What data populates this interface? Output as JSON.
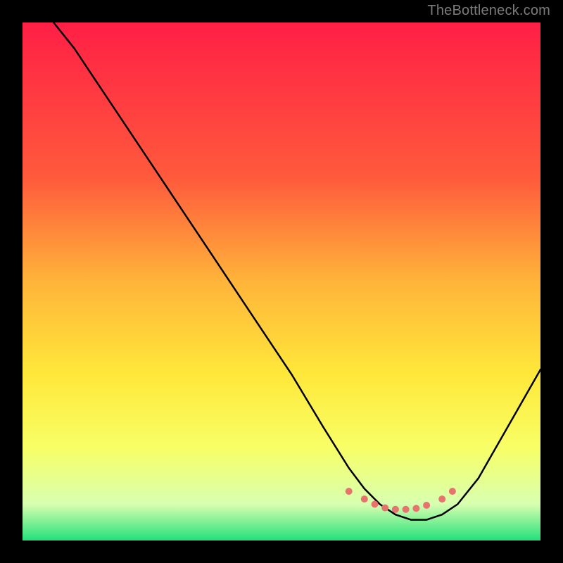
{
  "watermark": "TheBottleneck.com",
  "chart_data": {
    "type": "line",
    "title": "",
    "xlabel": "",
    "ylabel": "",
    "xlim": [
      0,
      100
    ],
    "ylim": [
      0,
      100
    ],
    "gradient_stops": [
      {
        "offset": 0,
        "color": "#ff1f46"
      },
      {
        "offset": 0.3,
        "color": "#ff5a3c"
      },
      {
        "offset": 0.5,
        "color": "#ffb43a"
      },
      {
        "offset": 0.68,
        "color": "#ffe83a"
      },
      {
        "offset": 0.82,
        "color": "#f8ff66"
      },
      {
        "offset": 0.93,
        "color": "#d8ffb0"
      },
      {
        "offset": 1.0,
        "color": "#23e07b"
      }
    ],
    "series": [
      {
        "name": "bottleneck-curve",
        "color": "#000000",
        "x": [
          6,
          10,
          14,
          20,
          28,
          36,
          44,
          52,
          58,
          63,
          66,
          69,
          72,
          75,
          78,
          81,
          84,
          88,
          92,
          96,
          100
        ],
        "y": [
          100,
          95,
          89,
          80,
          68,
          56,
          44,
          32,
          22,
          14,
          10,
          7,
          5,
          4,
          4,
          5,
          7,
          12,
          19,
          26,
          33
        ]
      }
    ],
    "markers": {
      "name": "highlight-dots",
      "color": "#e8736e",
      "radius": 5,
      "x": [
        63,
        66,
        68,
        70,
        72,
        74,
        76,
        78,
        81,
        83
      ],
      "y": [
        9.5,
        8,
        7,
        6.3,
        6,
        6,
        6.2,
        6.8,
        8,
        9.5
      ]
    }
  }
}
